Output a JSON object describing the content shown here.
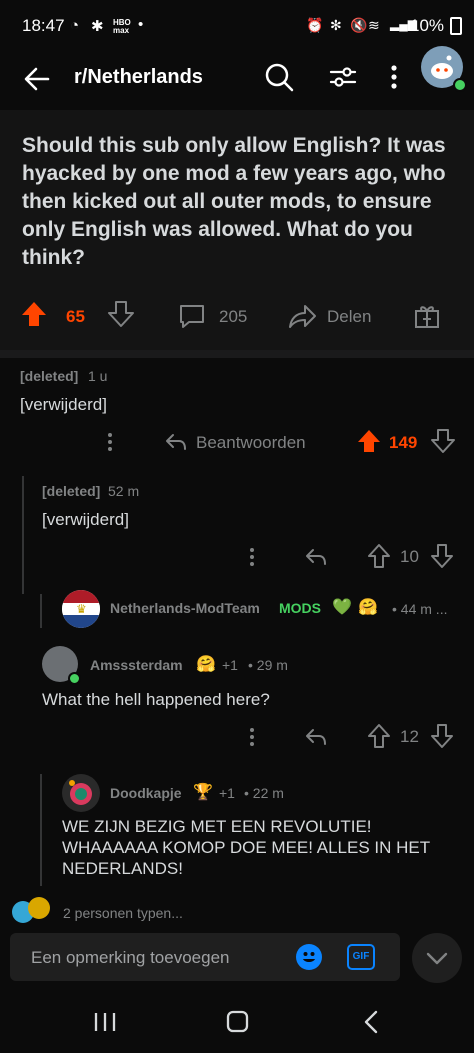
{
  "status": {
    "time": "18:47",
    "battery": "10%",
    "hbo": "HBO max"
  },
  "appbar": {
    "title": "r/Netherlands"
  },
  "post": {
    "title": "Should this sub only allow English? It was hyacked by one mod a few years ago, who then kicked out all outer mods, to ensure only English was allowed. What do you think?",
    "votes": "65",
    "comments": "205",
    "share": "Delen"
  },
  "comments": [
    {
      "author": "[deleted]",
      "age": "1 u",
      "text": "[verwijderd]",
      "reply": "Beantwoorden",
      "votes": "149"
    },
    {
      "author": "[deleted]",
      "age": "52 m",
      "text": "[verwijderd]",
      "votes": "10"
    },
    {
      "author": "Netherlands-ModTeam",
      "flair": "MODS",
      "age": "• 44 m ..."
    },
    {
      "author": "Amsssterdam",
      "plus": "+1",
      "age": "• 29 m",
      "text": "What the hell happened here?",
      "votes": "12"
    },
    {
      "author": "Doodkapje",
      "plus": "+1",
      "age": "• 22 m",
      "text": "WE ZIJN BEZIG MET EEN REVOLUTIE! WHAAAAAA KOMOP DOE MEE! ALLES IN HET NEDERLANDS!"
    }
  ],
  "typing": "2 personen typen...",
  "composer": {
    "placeholder": "Een opmerking toevoegen",
    "gif": "GIF"
  },
  "colors": {
    "upvote": "#ff4500",
    "mods": "#46d160",
    "background": "#0b0b0b"
  }
}
